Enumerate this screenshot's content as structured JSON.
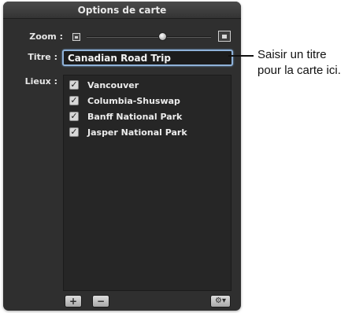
{
  "panel": {
    "title": "Options de carte",
    "zoom_label": "Zoom :",
    "zoom_level": 0.7,
    "title_label": "Titre :",
    "title_value": "Canadian Road Trip",
    "places_label": "Lieux :",
    "places": [
      {
        "name": "Vancouver",
        "checked": true
      },
      {
        "name": "Columbia-Shuswap",
        "checked": true
      },
      {
        "name": "Banff National Park",
        "checked": true
      },
      {
        "name": "Jasper National Park",
        "checked": true
      }
    ],
    "buttons": {
      "add": "+",
      "remove": "−",
      "action": "⚙▾"
    },
    "icons": {
      "zoom_out": "zoom-out-icon",
      "zoom_in": "zoom-in-icon",
      "checkbox": "checkmark-icon"
    },
    "accent_color": "#8fb2d9"
  },
  "callout": {
    "line1": "Saisir un titre",
    "line2": "pour la carte ici."
  }
}
